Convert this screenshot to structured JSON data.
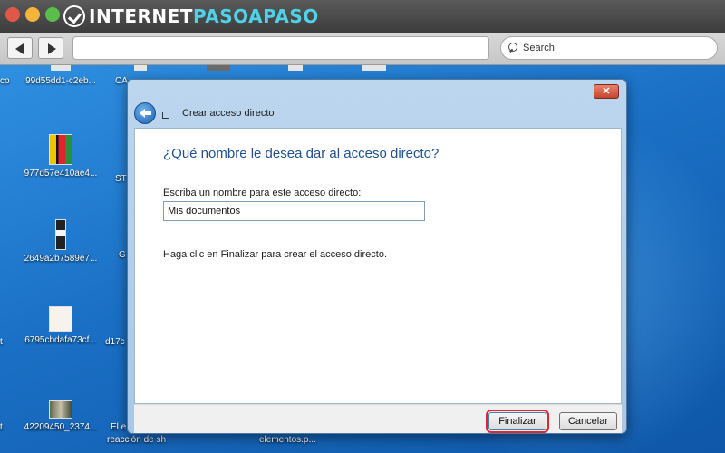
{
  "browser": {
    "brand_part1": "INTERNET",
    "brand_part2": "PASOAPASO",
    "search_placeholder": "Search"
  },
  "desktop": {
    "icons": [
      {
        "label": "99d55dd1-c2eb..."
      },
      {
        "label": "977d57e410ae4..."
      },
      {
        "label": "2649a2b7589e7..."
      },
      {
        "label": "6795cbdafa73cf..."
      },
      {
        "label": "42209450_2374..."
      }
    ],
    "fragments": [
      "co",
      "CA",
      "ST",
      "G",
      "d17c",
      "El e",
      "reacción de sh",
      "elementos.p...",
      "t"
    ]
  },
  "dialog": {
    "close_label": "✕",
    "title": "Crear acceso directo",
    "heading": "¿Qué nombre le desea dar al acceso directo?",
    "field_label": "Escriba un nombre para este acceso directo:",
    "field_value": "Mis documentos",
    "hint": "Haga clic en Finalizar para crear el acceso directo.",
    "finish_label": "Finalizar",
    "cancel_label": "Cancelar"
  },
  "colors": {
    "desktop_blue": "#1a6fc4",
    "heading_blue": "#1e4f8f",
    "highlight_red": "#e0242e"
  }
}
